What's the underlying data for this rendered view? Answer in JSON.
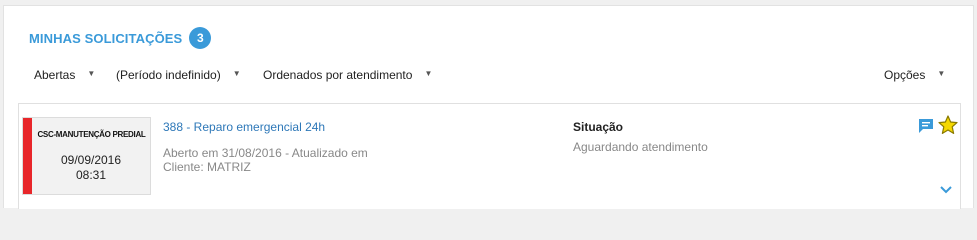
{
  "header": {
    "title": "MINHAS SOLICITAÇÕES",
    "count": "3"
  },
  "filters": {
    "status": "Abertas",
    "period": "(Período indefinido)",
    "order": "Ordenados por atendimento",
    "options": "Opções",
    "caret": "▼"
  },
  "request": {
    "department": "CSC-MANUTENÇÃO PREDIAL",
    "date": "09/09/2016",
    "time": "08:31",
    "title": "388 - Reparo emergencial 24h",
    "opened_info": "Aberto em 31/08/2016 - Atualizado em",
    "client": "Cliente: MATRIZ",
    "status_label": "Situação",
    "status_value": "Aguardando atendimento",
    "priority_color": "#e8262a"
  },
  "icons": {
    "comment": "comment-icon",
    "star": "star-icon",
    "expand": "chevron-down-icon"
  },
  "colors": {
    "accent": "#3a9ad9",
    "link": "#2e78b8",
    "star": "#f5d800"
  }
}
